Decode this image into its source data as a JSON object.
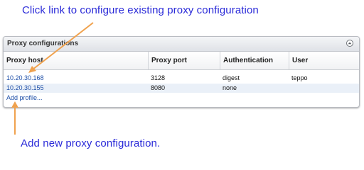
{
  "callouts": {
    "top": "Click link to configure existing proxy configuration",
    "bottom": "Add new proxy configuration."
  },
  "panel": {
    "title": "Proxy configurations",
    "columns": [
      "Proxy host",
      "Proxy port",
      "Authentication",
      "User"
    ],
    "rows": [
      {
        "host": "10.20.30.168",
        "port": "3128",
        "auth": "digest",
        "user": "teppo"
      },
      {
        "host": "10.20.30.155",
        "port": "8080",
        "auth": "none",
        "user": ""
      }
    ],
    "add_link": "Add profile..."
  },
  "colors": {
    "callout_text": "#2a2ad8",
    "arrow": "#f0a24e",
    "link": "#1e4fa8",
    "alt_row": "#eaf0f8"
  },
  "icons": {
    "collapse": "collapse-up-icon",
    "arrow_top": "arrow-icon",
    "arrow_bottom": "arrow-icon"
  }
}
